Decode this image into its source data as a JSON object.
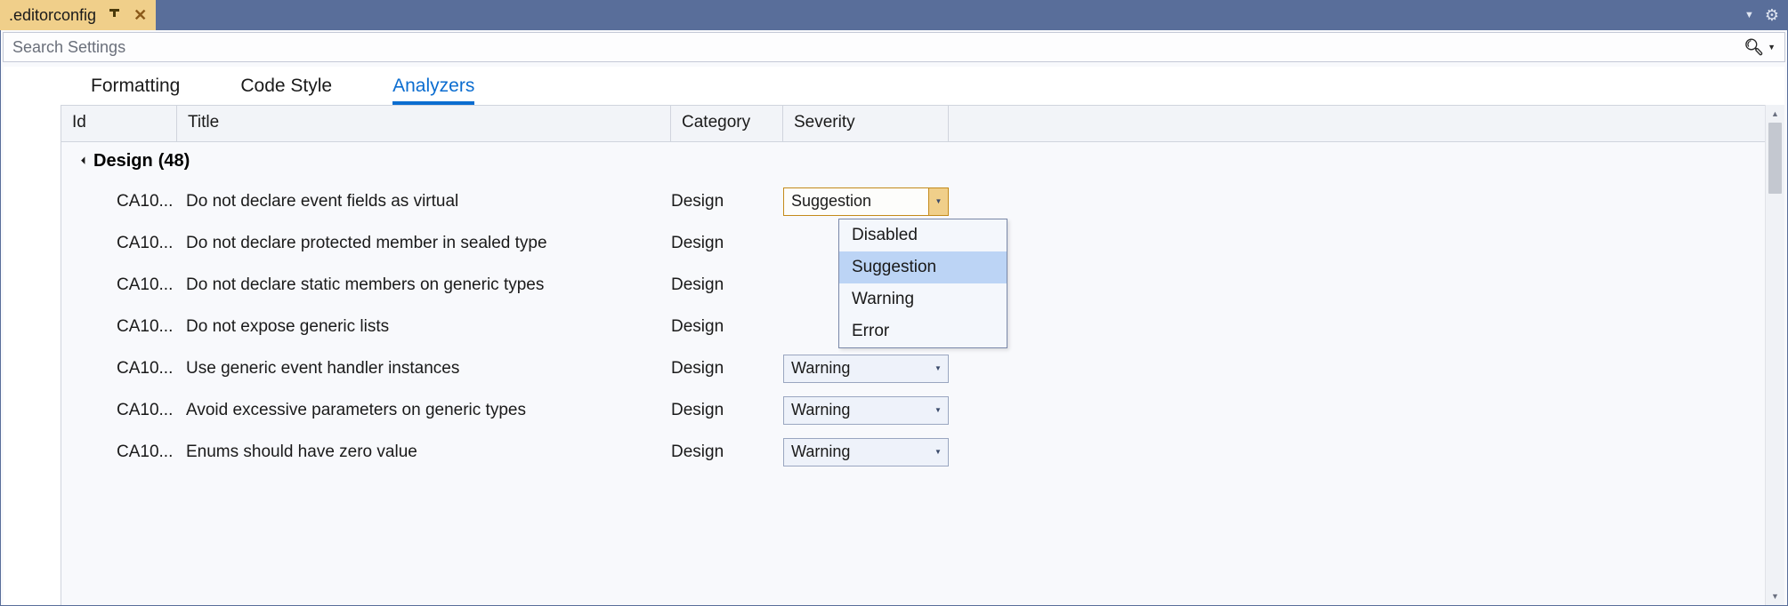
{
  "window": {
    "tab_title": ".editorconfig"
  },
  "search": {
    "placeholder": "Search Settings"
  },
  "tabs": {
    "formatting": "Formatting",
    "code_style": "Code Style",
    "analyzers": "Analyzers"
  },
  "grid_headers": {
    "id": "Id",
    "title": "Title",
    "category": "Category",
    "severity": "Severity"
  },
  "group": {
    "name": "Design",
    "count": "(48)"
  },
  "rows": [
    {
      "id": "CA10...",
      "title": "Do not declare event fields as virtual",
      "category": "Design",
      "severity": "Suggestion",
      "focused": true
    },
    {
      "id": "CA10...",
      "title": "Do not declare protected member in sealed type",
      "category": "Design",
      "severity": ""
    },
    {
      "id": "CA10...",
      "title": "Do not declare static members on generic types",
      "category": "Design",
      "severity": ""
    },
    {
      "id": "CA10...",
      "title": "Do not expose generic lists",
      "category": "Design",
      "severity": ""
    },
    {
      "id": "CA10...",
      "title": "Use generic event handler instances",
      "category": "Design",
      "severity": "Warning"
    },
    {
      "id": "CA10...",
      "title": "Avoid excessive parameters on generic types",
      "category": "Design",
      "severity": "Warning"
    },
    {
      "id": "CA10...",
      "title": "Enums should have zero value",
      "category": "Design",
      "severity": "Warning"
    }
  ],
  "dropdown_options": {
    "disabled": "Disabled",
    "suggestion": "Suggestion",
    "warning": "Warning",
    "error": "Error"
  }
}
